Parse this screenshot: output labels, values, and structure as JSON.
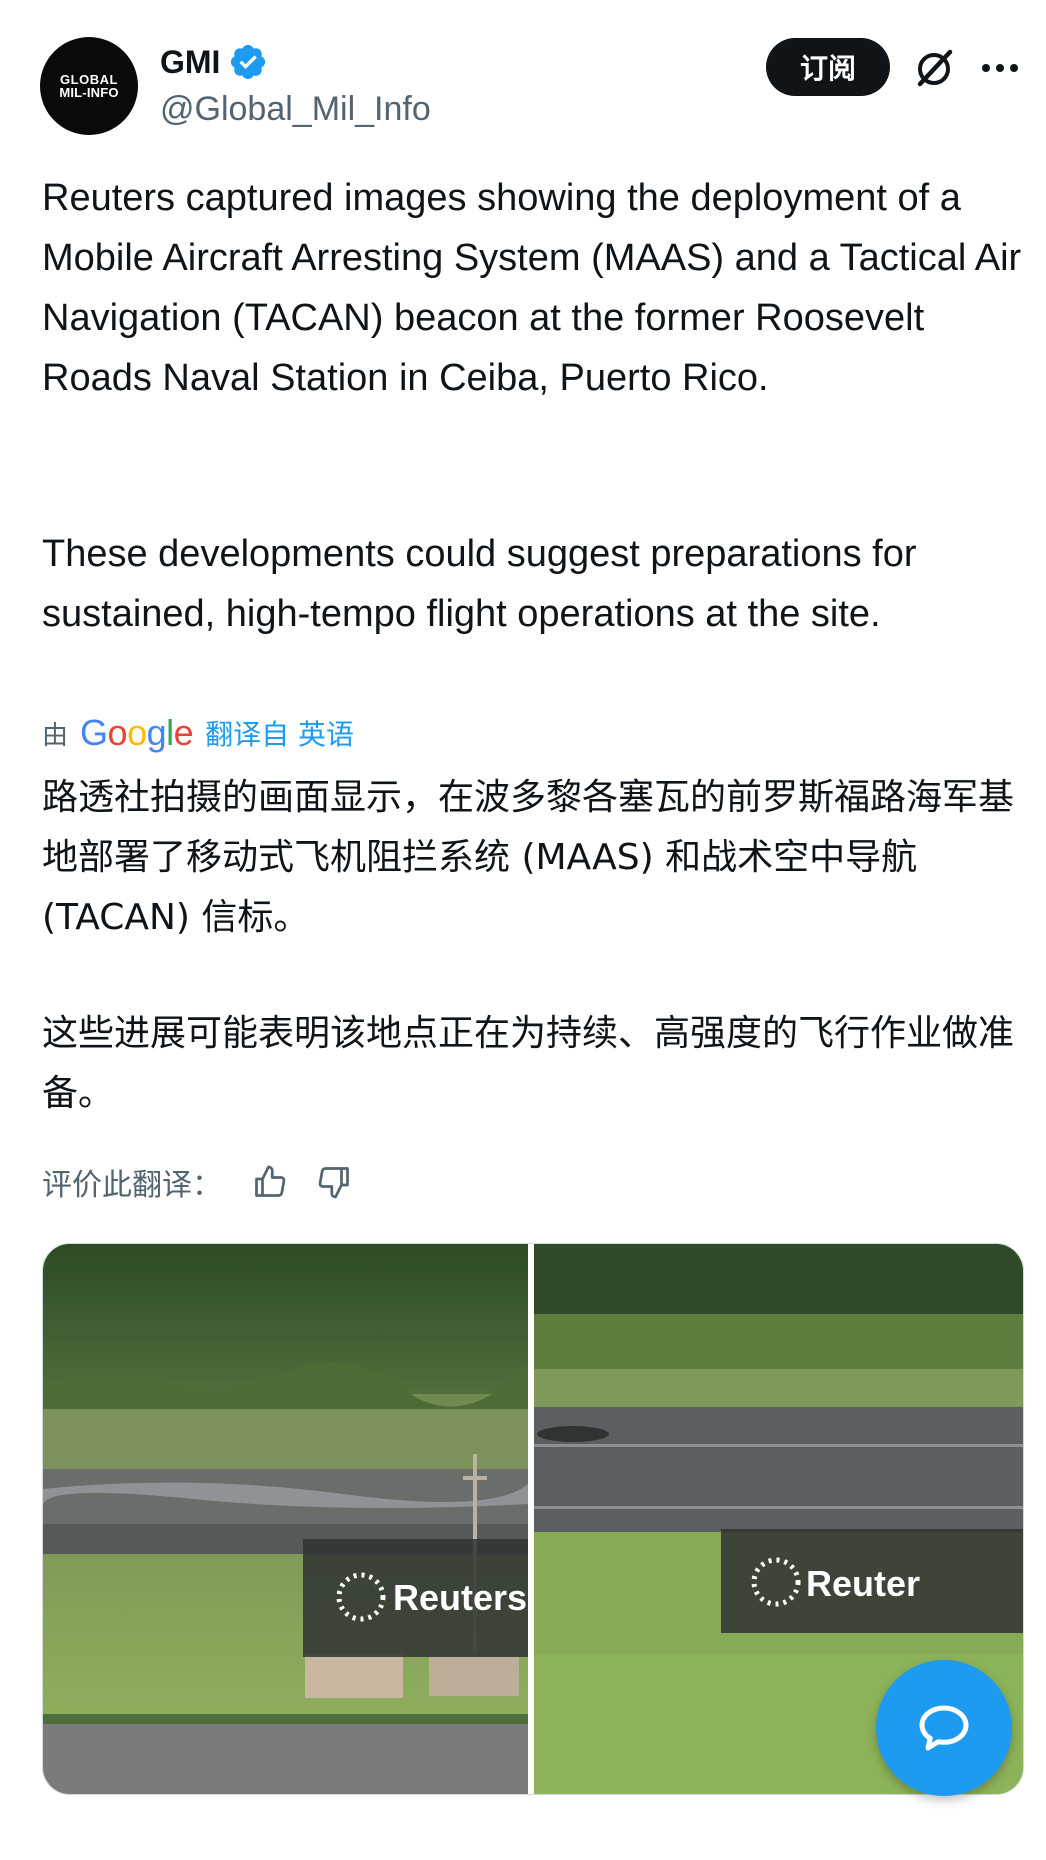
{
  "account": {
    "avatar_line1": "GLOBAL",
    "avatar_line2": "MIL-INFO",
    "name": "GMI",
    "handle": "@Global_Mil_Info"
  },
  "header": {
    "subscribe_label": "订阅"
  },
  "tweet": {
    "paragraph1": "Reuters captured images showing the deployment of a Mobile Aircraft Arresting System (MAAS) and a Tactical Air Navigation (TACAN) beacon at the former Roosevelt Roads Naval Station in Ceiba, Puerto Rico.",
    "paragraph2": "These developments could suggest preparations for sustained, high-tempo flight operations at the site."
  },
  "translation": {
    "by_label": "由",
    "provider": "Google",
    "from_label": "翻译自 英语",
    "paragraph1": "路透社拍摄的画面显示，在波多黎各塞瓦的前罗斯福路海军基地部署了移动式飞机阻拦系统 (MAAS) 和战术空中导航 (TACAN) 信标。",
    "paragraph2": "这些进展可能表明该地点正在为持续、高强度的飞行作业做准备。",
    "rate_label": "评价此翻译："
  },
  "media": {
    "image1_watermark": "Reuters",
    "image2_watermark": "Reuter"
  },
  "colors": {
    "accent": "#1d9bf0",
    "text": "#0f1419",
    "muted": "#536471"
  },
  "icons": [
    "verified-badge-icon",
    "grok-icon",
    "more-icon",
    "thumbs-up-icon",
    "thumbs-down-icon",
    "chat-bubble-icon"
  ]
}
